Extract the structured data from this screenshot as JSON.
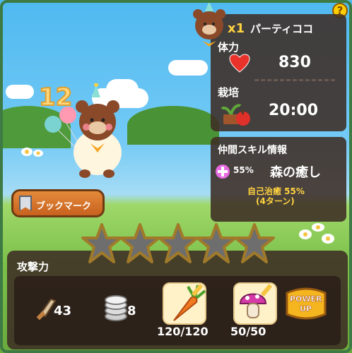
{
  "character": {
    "name": "パーティココ",
    "multiplier": "x1",
    "hp_label": "体力",
    "hp_value": "830",
    "cultivation_label": "栽培",
    "cultivation_time": "20:00"
  },
  "skill": {
    "header": "仲間スキル情報",
    "percent": "55%",
    "name": "森の癒し",
    "desc_line1": "自己治癒 55%",
    "desc_line2": "(4ターン)"
  },
  "bookmark_label": "ブックマーク",
  "stars": {
    "filled": 0,
    "total": 5
  },
  "attack": {
    "label": "攻撃力",
    "sword_value": "43",
    "coins_value": "8",
    "carrot_value": "120/120",
    "mushroom_value": "50/50",
    "power_up_line1": "POWER",
    "power_up_line2": "UP"
  },
  "balloon_number": "12",
  "help_label": "?",
  "colors": {
    "panel": "#3e2c24",
    "accent_yellow": "#ffd23f",
    "skill_text": "#ffd23f"
  },
  "icons": [
    "question-icon",
    "heart-icon",
    "plant-icon",
    "heal-icon",
    "bookmark-icon",
    "star-icon",
    "sword-icon",
    "coins-icon",
    "carrot-icon",
    "mushroom-icon",
    "pencil-icon"
  ]
}
